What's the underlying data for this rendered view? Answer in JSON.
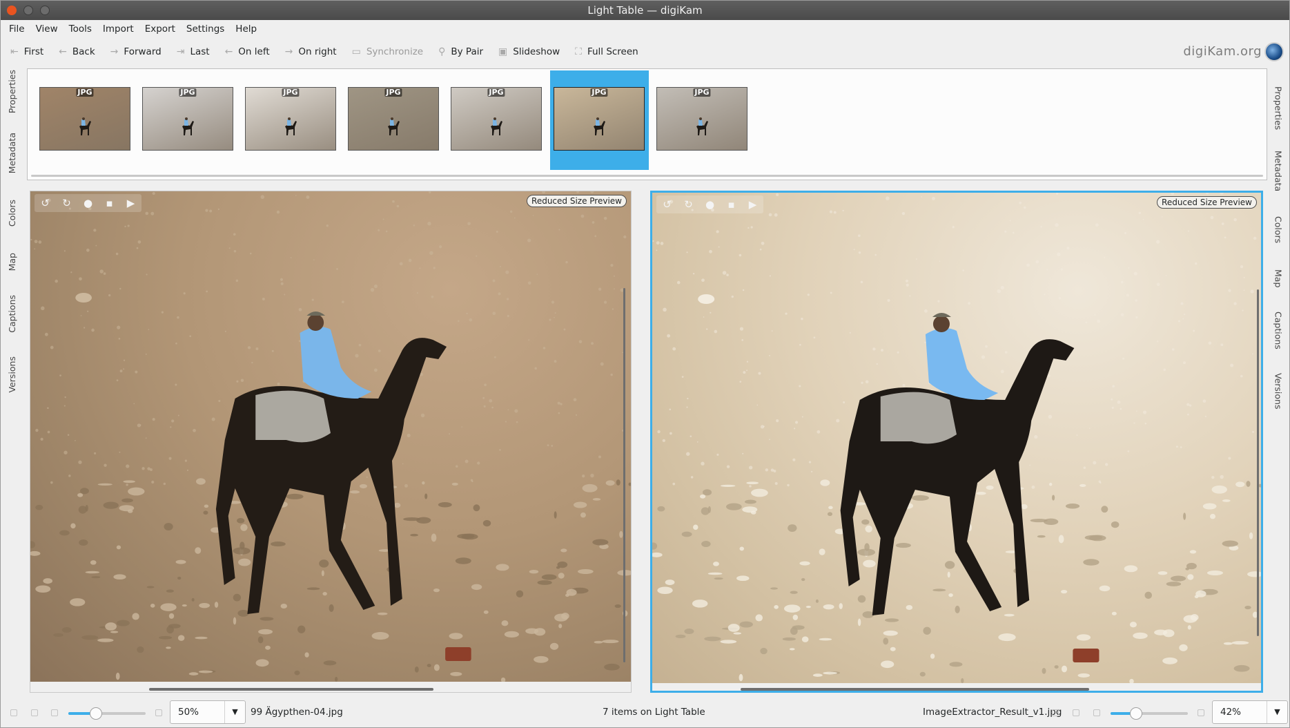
{
  "window": {
    "title": "Light Table — digiKam"
  },
  "menu": [
    "File",
    "View",
    "Tools",
    "Import",
    "Export",
    "Settings",
    "Help"
  ],
  "toolbar": {
    "first": "First",
    "back": "Back",
    "forward": "Forward",
    "last": "Last",
    "on_left": "On left",
    "on_right": "On right",
    "synchronize": "Synchronize",
    "by_pair": "By Pair",
    "slideshow": "Slideshow",
    "full_screen": "Full Screen",
    "brand": "digiKam.org"
  },
  "left_tabs": [
    "Properties",
    "Metadata",
    "Colors",
    "Map",
    "Captions",
    "Versions"
  ],
  "right_tabs": [
    "Properties",
    "Metadata",
    "Colors",
    "Map",
    "Captions",
    "Versions"
  ],
  "thumbnails": {
    "badge": "JPG",
    "count": 7,
    "selected_index": 5,
    "tints": [
      "#a08468",
      "#d5d2cf",
      "#e0dbd4",
      "#9f9584",
      "#cfcac3",
      "#c9b79a",
      "#c2bdb6"
    ]
  },
  "left_pane": {
    "badge": "Reduced Size Preview",
    "zoom": "50%",
    "filename": "99 Ägypthen-04.jpg",
    "zoom_slider_fraction": 0.36
  },
  "right_pane": {
    "badge": "Reduced Size Preview",
    "zoom": "42%",
    "filename": "ImageExtractor_Result_v1.jpg",
    "zoom_slider_fraction": 0.33
  },
  "status": {
    "center": "7 items on Light Table"
  },
  "colors": {
    "accent": "#3daee9",
    "titlebar": "#4f4f4f",
    "close": "#e95420"
  }
}
